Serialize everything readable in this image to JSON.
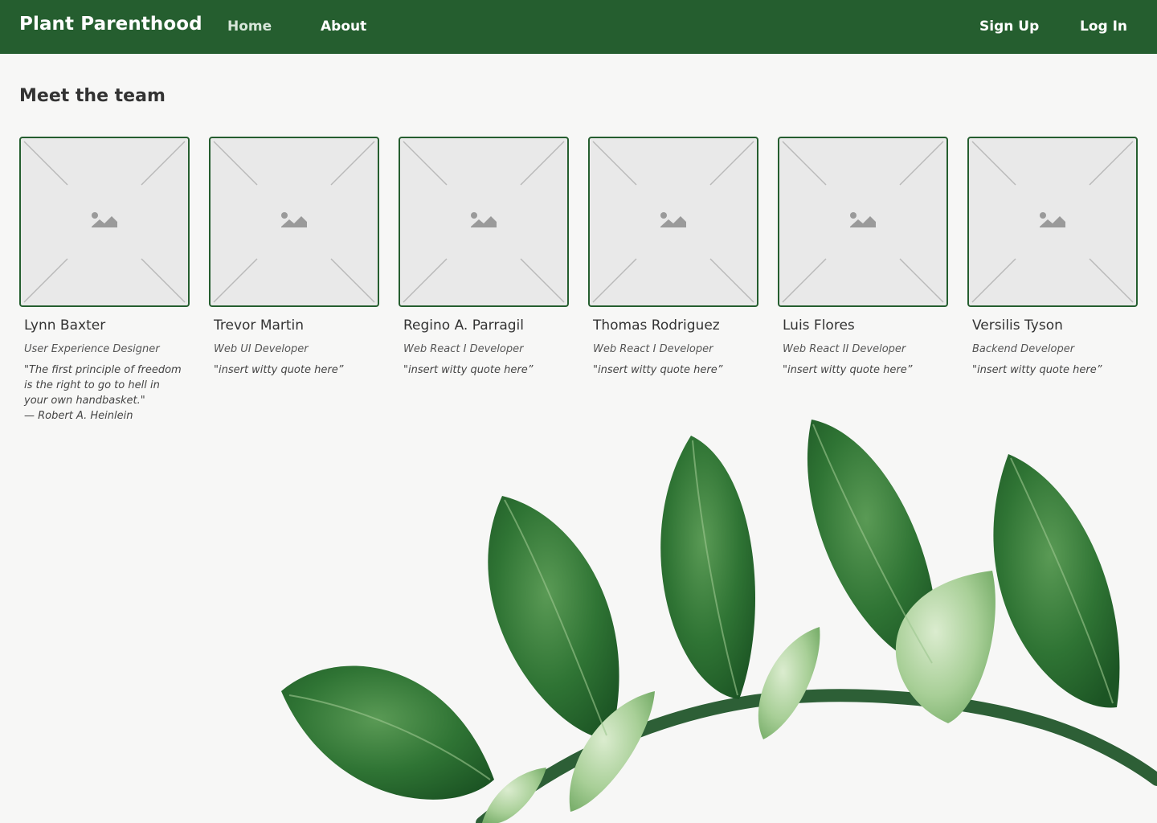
{
  "nav": {
    "brand": "Plant Parenthood",
    "home": "Home",
    "about": "About",
    "signup": "Sign Up",
    "login": "Log In"
  },
  "page": {
    "title": "Meet the team"
  },
  "team": [
    {
      "name": "Lynn Baxter",
      "role": "User Experience Designer",
      "quote": "\"The first principle of freedom\nis the right to go to hell in\nyour own handbasket.\"\n— Robert A. Heinlein"
    },
    {
      "name": "Trevor Martin",
      "role": "Web UI Developer",
      "quote": "\"insert witty quote here”"
    },
    {
      "name": "Regino A. Parragil",
      "role": "Web React I Developer",
      "quote": "\"insert witty quote here”"
    },
    {
      "name": "Thomas Rodriguez",
      "role": "Web React I Developer",
      "quote": "\"insert witty quote here”"
    },
    {
      "name": "Luis Flores",
      "role": "Web React II Developer",
      "quote": "\"insert witty quote here”"
    },
    {
      "name": "Versilis Tyson",
      "role": "Backend Developer",
      "quote": "\"insert witty quote here”"
    }
  ],
  "icons": {
    "photo_placeholder": "image-placeholder-icon",
    "background": "plant-leaves-illustration"
  },
  "colors": {
    "brand_green": "#255e2f",
    "page_background": "#f7f7f6",
    "placeholder_fill": "#e9e9e9"
  }
}
